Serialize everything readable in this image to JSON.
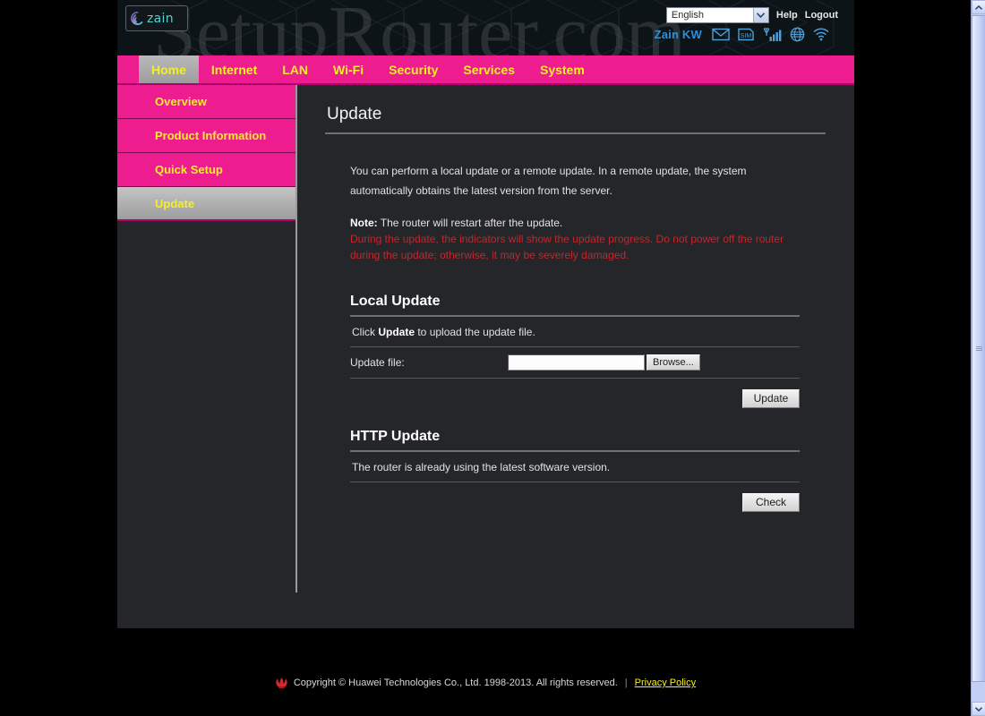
{
  "header": {
    "logo_alt": "zain",
    "logo_text": "zain",
    "watermark": "SetupRouter.com",
    "language": {
      "selected": "English",
      "options": [
        "English"
      ]
    },
    "help_label": "Help",
    "logout_label": "Logout",
    "carrier": "Zain KW",
    "status_icons": [
      "mail-icon",
      "sim-card-icon",
      "signal-bars-icon",
      "globe-icon",
      "wifi-icon"
    ]
  },
  "nav": {
    "items": [
      {
        "label": "Home",
        "active": true
      },
      {
        "label": "Internet",
        "active": false
      },
      {
        "label": "LAN",
        "active": false
      },
      {
        "label": "Wi-Fi",
        "active": false
      },
      {
        "label": "Security",
        "active": false
      },
      {
        "label": "Services",
        "active": false
      },
      {
        "label": "System",
        "active": false
      }
    ]
  },
  "sidebar": {
    "items": [
      {
        "label": "Overview",
        "active": false
      },
      {
        "label": "Product Information",
        "active": false
      },
      {
        "label": "Quick Setup",
        "active": false
      },
      {
        "label": "Update",
        "active": true
      }
    ]
  },
  "main": {
    "page_title": "Update",
    "intro": "You can perform a local update or a remote update. In a remote update, the system automatically obtains the latest version from the server.",
    "note_label": "Note:",
    "note_text": " The router will restart after the update.",
    "warning": "During the update, the indicators will show the update progress. Do not power off the router during the update; otherwise, it may be severely damaged.",
    "local_update": {
      "title": "Local Update",
      "instruction_prefix": "Click ",
      "instruction_bold": "Update",
      "instruction_suffix": " to upload the update file.",
      "file_label": "Update file:",
      "file_value": "",
      "file_placeholder": "",
      "browse_label": "Browse...",
      "submit_label": "Update"
    },
    "http_update": {
      "title": "HTTP Update",
      "status_text": "The router is already using the latest software version.",
      "check_label": "Check"
    }
  },
  "footer": {
    "logo_alt": "huawei-logo",
    "copyright": "Copyright © Huawei Technologies Co., Ltd. 1998-2013. All rights reserved.",
    "separator": "|",
    "privacy_label": "Privacy Policy"
  },
  "colors": {
    "brand_pink": "#ed1d8f",
    "brand_yellow": "#f5ee2a",
    "panel_dark": "#252629",
    "header_dark": "#0d1418",
    "warning_red": "#c1272d",
    "carrier_blue": "#2f8fd6",
    "logo_teal": "#4fd4cf"
  },
  "scrollbar": {
    "up_arrow": "chevron-up-icon",
    "down_arrow": "chevron-down-icon"
  }
}
